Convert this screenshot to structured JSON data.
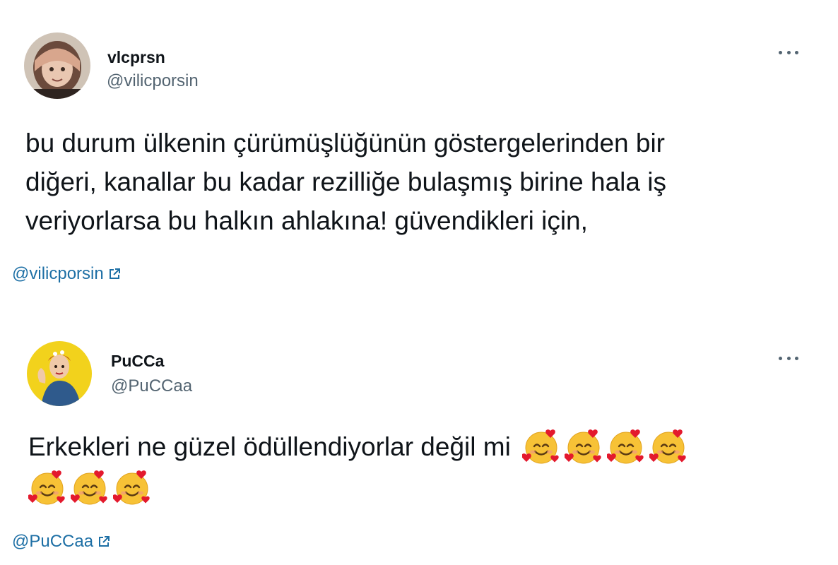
{
  "tweets": [
    {
      "display_name": "vlcprsn",
      "handle": "@vilicporsin",
      "text_lines": [
        "bu durum ülkenin çürümüşlüğünün göstergelerinden bir",
        "diğeri, kanallar bu kadar rezilliğe bulaşmış birine hala iş",
        "veriyorlarsa bu halkın ahlakına! güvendikleri için,"
      ],
      "source_link": "@vilicporsin",
      "more_icon": "more-horizontal-icon"
    },
    {
      "display_name": "PuCCa",
      "handle": "@PuCCaa",
      "text": "Erkekleri ne güzel ödüllendiyorlar değil mi",
      "emoji": "smiling-face-with-hearts",
      "emoji_count_line1": 4,
      "emoji_count_line2": 3,
      "source_link": "@PuCCaa",
      "more_icon": "more-horizontal-icon"
    }
  ],
  "colors": {
    "text": "#0f1419",
    "secondary": "#536471",
    "link": "#1d6fa5",
    "avatar2_bg": "#f2d21c"
  }
}
